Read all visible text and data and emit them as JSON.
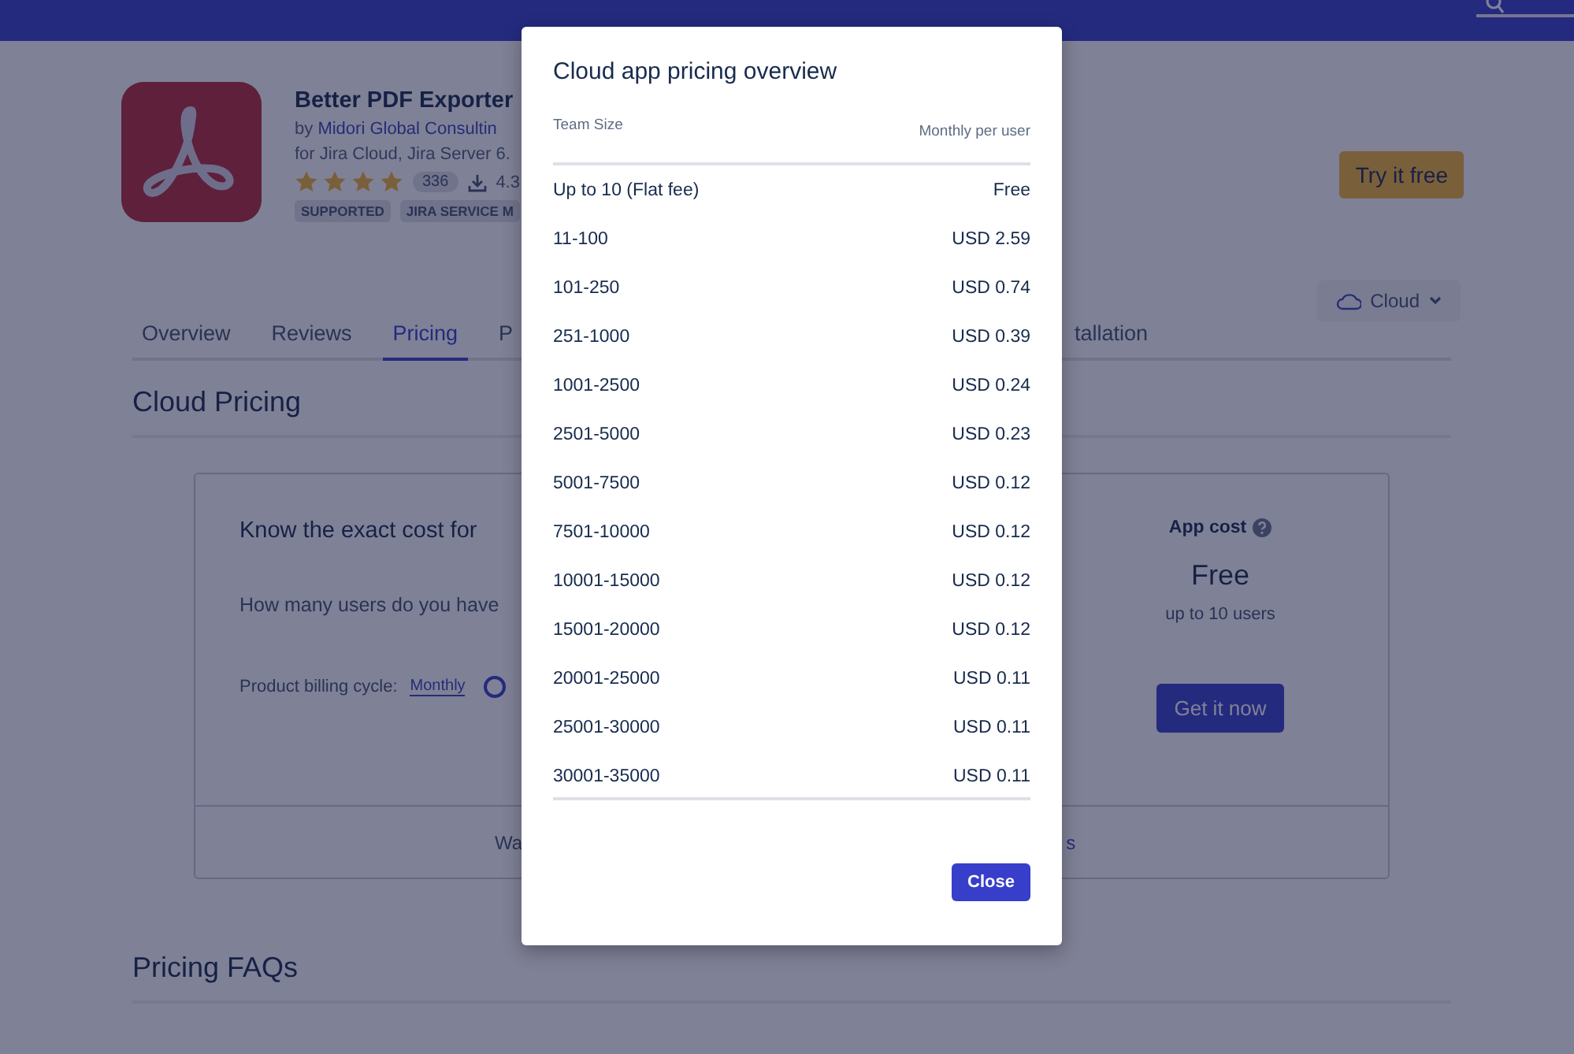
{
  "app": {
    "name": "Better PDF Exporter",
    "by": "by",
    "vendor": "Midori Global Consultin",
    "hosting": "for Jira Cloud, Jira Server 6.",
    "stars": 4,
    "review_count": "336",
    "installs": "4.3",
    "tags": [
      "SUPPORTED",
      "JIRA SERVICE M"
    ],
    "try_button": "Try it free"
  },
  "tabs": [
    {
      "label": "Overview",
      "selected": false
    },
    {
      "label": "Reviews",
      "selected": false
    },
    {
      "label": "Pricing",
      "selected": true
    },
    {
      "label": "P",
      "selected": false
    },
    {
      "label": "tallation",
      "selected": false
    }
  ],
  "hosting_select": "Cloud",
  "section_title": "Cloud Pricing",
  "pricing_card": {
    "title": "Know the exact cost for",
    "question": "How many users do you have",
    "billing_label": "Product billing cycle:",
    "billing_value": "Monthly",
    "cost_label": "App cost",
    "cost_value": "Free",
    "cost_note": "up to 10 users",
    "cta": "Get it now",
    "footer_left": "Wa",
    "footer_right": "s"
  },
  "faq_title": "Pricing FAQs",
  "modal": {
    "title": "Cloud app pricing overview",
    "columns": [
      "Team Size",
      "Monthly per user"
    ],
    "rows": [
      [
        "Up to 10 (Flat fee)",
        "Free"
      ],
      [
        "11-100",
        "USD 2.59"
      ],
      [
        "101-250",
        "USD 0.74"
      ],
      [
        "251-1000",
        "USD 0.39"
      ],
      [
        "1001-2500",
        "USD 0.24"
      ],
      [
        "2501-5000",
        "USD 0.23"
      ],
      [
        "5001-7500",
        "USD 0.12"
      ],
      [
        "7501-10000",
        "USD 0.12"
      ],
      [
        "10001-15000",
        "USD 0.12"
      ],
      [
        "15001-20000",
        "USD 0.12"
      ],
      [
        "20001-25000",
        "USD 0.11"
      ],
      [
        "25001-30000",
        "USD 0.11"
      ],
      [
        "30001-35000",
        "USD 0.11"
      ]
    ],
    "close": "Close"
  }
}
